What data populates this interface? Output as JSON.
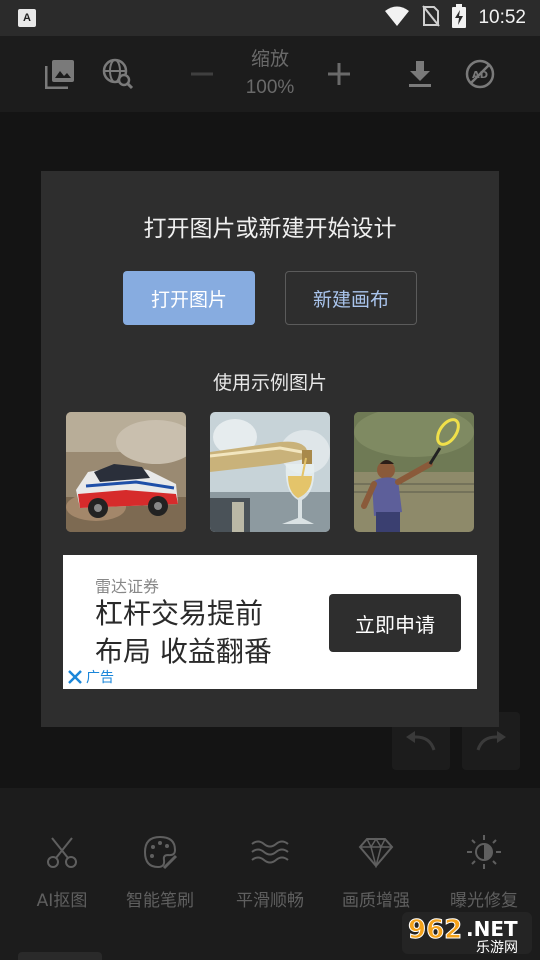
{
  "status_bar": {
    "time": "10:52",
    "app_icon_letter": "A",
    "icons": [
      "wifi-icon",
      "no-sim-icon",
      "battery-charging-icon"
    ]
  },
  "toolbar": {
    "icons": [
      "gallery-icon",
      "web-search-icon",
      "zoom-out-icon",
      "zoom-in-icon",
      "download-icon",
      "remove-ads-icon"
    ],
    "zoom_title": "缩放",
    "zoom_value": "100%"
  },
  "dialog": {
    "title": "打开图片或新建开始设计",
    "open_button": "打开图片",
    "new_button": "新建画布",
    "sample_title": "使用示例图片",
    "samples": [
      "rally-car",
      "wine-pour",
      "tennis-player"
    ]
  },
  "ad": {
    "brand": "雷达证券",
    "headline_line1": "杠杆交易提前",
    "headline_line2": "布局 收益翻番",
    "cta": "立即申请",
    "tag": "广告"
  },
  "bottom_tools": [
    {
      "label": "AI抠图",
      "icon": "scissors-icon"
    },
    {
      "label": "智能笔刷",
      "icon": "palette-brush-icon"
    },
    {
      "label": "平滑顺畅",
      "icon": "waves-icon"
    },
    {
      "label": "画质增强",
      "icon": "diamond-icon"
    },
    {
      "label": "曝光修复",
      "icon": "exposure-icon"
    }
  ],
  "watermark": {
    "number": "962",
    "suffix": ".NET",
    "site": "乐游网"
  },
  "colors": {
    "accent": "#87ace0",
    "dialog_bg": "#2e2e2e",
    "ad_tag": "#1a86d9"
  }
}
